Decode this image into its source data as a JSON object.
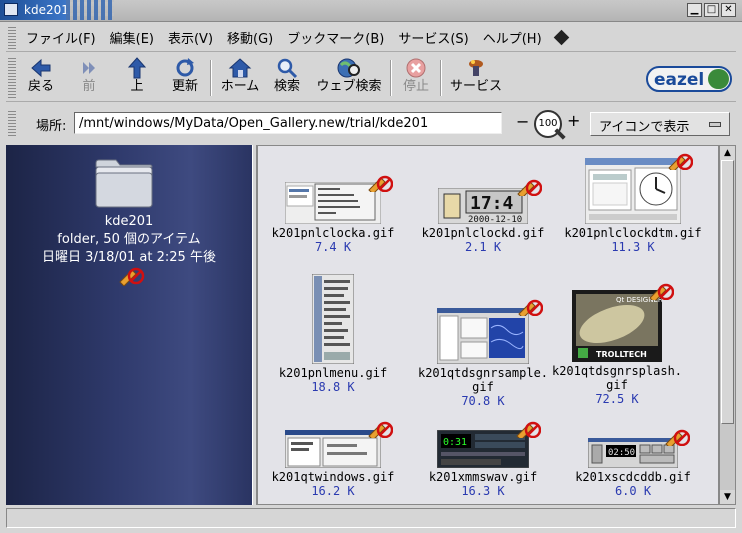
{
  "window": {
    "title": "kde201"
  },
  "menubar": {
    "items": [
      {
        "label": "ファイル(F)"
      },
      {
        "label": "編集(E)"
      },
      {
        "label": "表示(V)"
      },
      {
        "label": "移動(G)"
      },
      {
        "label": "ブックマーク(B)"
      },
      {
        "label": "サービス(S)"
      },
      {
        "label": "ヘルプ(H)"
      }
    ]
  },
  "toolbar": {
    "back": "戻る",
    "forward": "前",
    "up": "上",
    "reload": "更新",
    "home": "ホーム",
    "search": "検索",
    "web_search": "ウェブ検索",
    "stop": "停止",
    "services": "サービス",
    "logo_text": "eazel"
  },
  "location": {
    "label": "場所:",
    "path": "/mnt/windows/MyData/Open_Gallery.new/trial/kde201",
    "zoom_level": "100",
    "zoom_minus": "−",
    "zoom_plus": "+",
    "view_mode": "アイコンで表示"
  },
  "sidebar": {
    "folder_name": "kde201",
    "info": "folder, 50 個のアイテム",
    "date": "日曜日 3/18/01 at 2:25 午後"
  },
  "files": [
    {
      "name": "k201pnlclocka.gif",
      "size": "7.4 K"
    },
    {
      "name": "k201pnlclockd.gif",
      "size": "2.1 K"
    },
    {
      "name": "k201pnlclockdtm.gif",
      "size": "11.3 K"
    },
    {
      "name": "k201pnlmenu.gif",
      "size": "18.8 K"
    },
    {
      "name": "k201qtdsgnrsample.gif",
      "name_line1": "k201qtdsgnrsample.",
      "name_line2": "gif",
      "size": "70.8 K"
    },
    {
      "name": "k201qtdsgnrsplash.gif",
      "name_line1": "k201qtdsgnrsplash.",
      "name_line2": "gif",
      "size": "72.5 K"
    },
    {
      "name": "k201qtwindows.gif",
      "size": "16.2 K"
    },
    {
      "name": "k201xmmswav.gif",
      "size": "16.3 K"
    },
    {
      "name": "k201xscdcddb.gif",
      "size": "6.0 K"
    }
  ],
  "thumb_text": {
    "clockd_time": "17:4",
    "clockd_date": "2000-12-10",
    "splash_title": "Qt DESIGNER",
    "splash_brand": "TROLLTECH",
    "xmms_time": "0:31",
    "xscd_time": "02:50"
  },
  "colors": {
    "sidebar_bg": "#2f3a6c",
    "title_tab": "#1e4f96",
    "size_text": "#2a3ab0",
    "emblem_red": "#d01010"
  }
}
